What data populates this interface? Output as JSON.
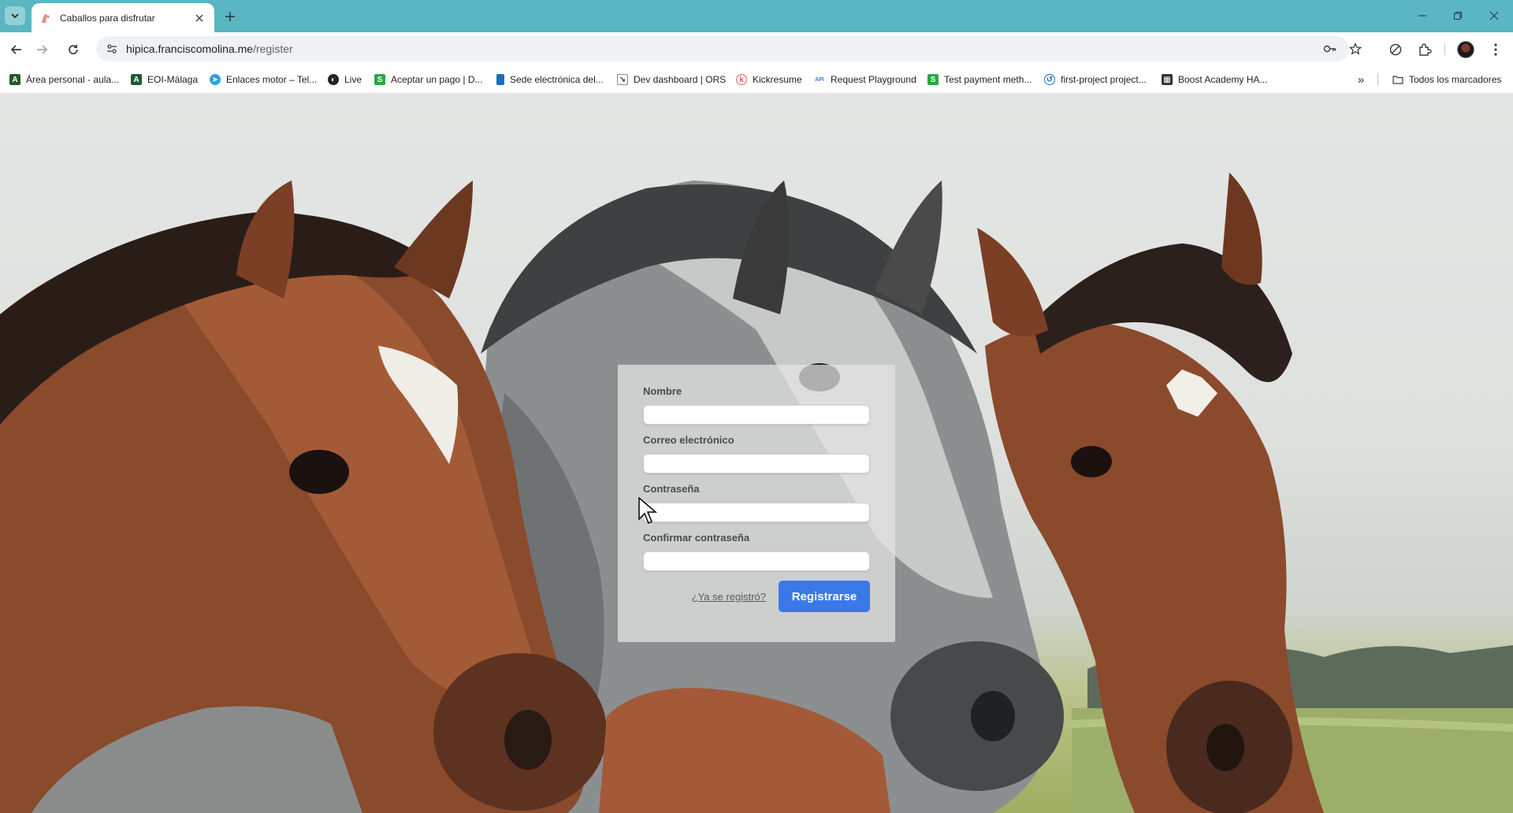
{
  "browser": {
    "tab": {
      "title": "Caballos para disfrutar"
    },
    "address_bar": {
      "host": "hipica.franciscomolina.me",
      "path": "/register"
    },
    "bookmarks": [
      {
        "label": "Área personal - aula...",
        "icon": "letter-a-icon"
      },
      {
        "label": "EOI-Málaga",
        "icon": "letter-a-icon"
      },
      {
        "label": "Enlaces motor – Tel...",
        "icon": "telegram-icon"
      },
      {
        "label": "Live",
        "icon": "live-icon"
      },
      {
        "label": "Aceptar un pago | D...",
        "icon": "letter-s-icon"
      },
      {
        "label": "Sede electrónica del...",
        "icon": "document-icon"
      },
      {
        "label": "Dev dashboard | ORS",
        "icon": "ors-icon"
      },
      {
        "label": "Kickresume",
        "icon": "kickresume-icon"
      },
      {
        "label": "Request Playground",
        "icon": "api-icon"
      },
      {
        "label": "Test payment meth...",
        "icon": "letter-s-icon"
      },
      {
        "label": "first-project project...",
        "icon": "project-icon"
      },
      {
        "label": "Boost Academy HA...",
        "icon": "building-icon"
      }
    ],
    "all_bookmarks_label": "Todos los marcadores",
    "colors": {
      "frame": "#5ab6c2",
      "omnibox": "#eef2f4"
    }
  },
  "form": {
    "name_label": "Nombre",
    "email_label": "Correo electrónico",
    "password_label": "Contraseña",
    "confirm_label": "Confirmar contraseña",
    "login_link": "¿Ya se registró?",
    "submit_label": "Registrarse",
    "colors": {
      "submit": "#3b78e7",
      "card": "rgba(228,228,228,0.74)"
    }
  },
  "background_image": "three-horses-photo"
}
